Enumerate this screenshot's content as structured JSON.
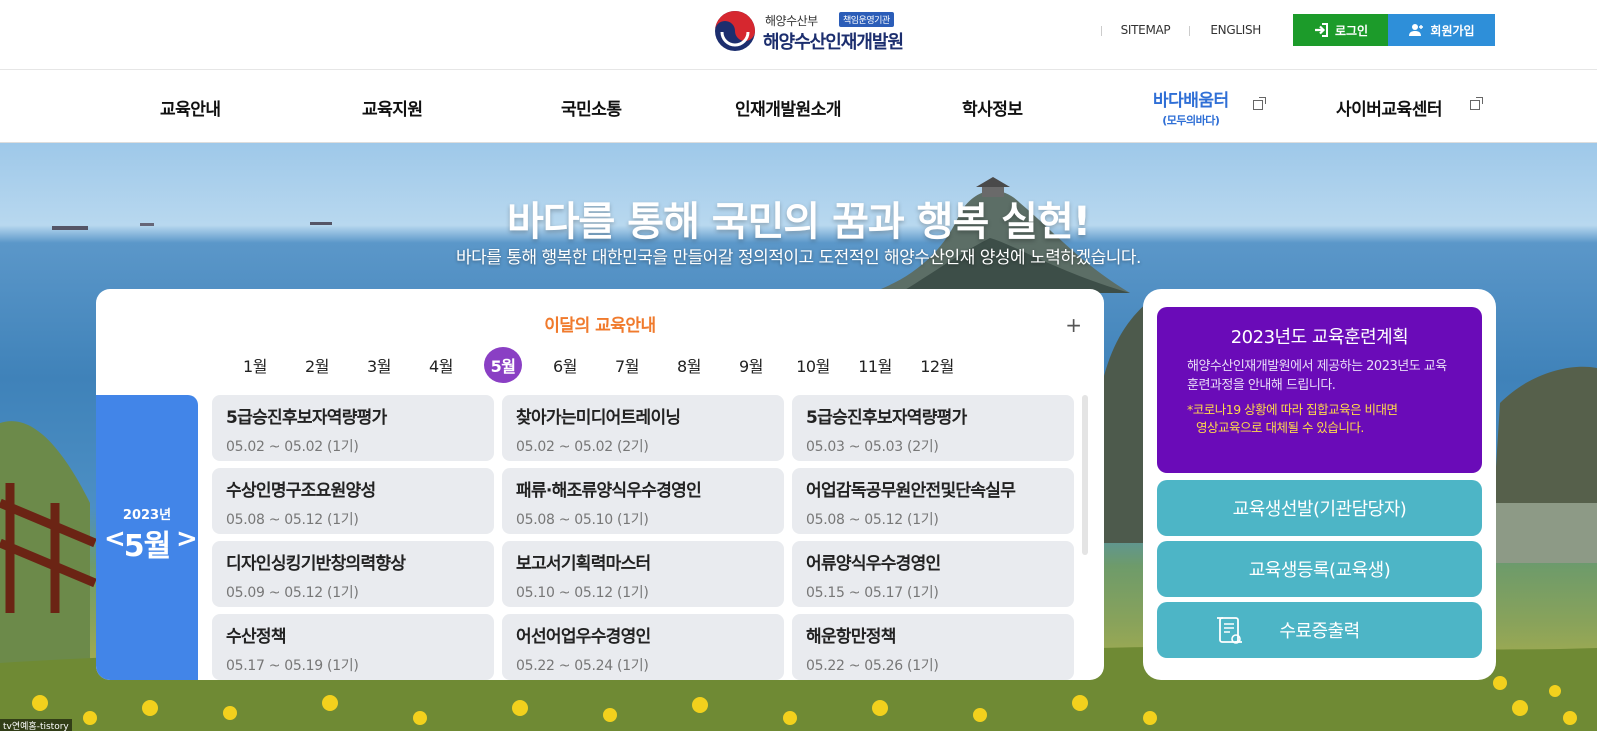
{
  "header": {
    "ministry": "해양수산부",
    "badge": "책임운영기관",
    "org_name": "해양수산인재개발원",
    "links": [
      "SITEMAP",
      "ENGLISH"
    ],
    "login_label": "로그인",
    "join_label": "회원가입"
  },
  "gnb": [
    {
      "label": "교육안내",
      "sub": ""
    },
    {
      "label": "교육지원",
      "sub": ""
    },
    {
      "label": "국민소통",
      "sub": ""
    },
    {
      "label": "인재개발원소개",
      "sub": ""
    },
    {
      "label": "학사정보",
      "sub": ""
    },
    {
      "label": "바다배움터",
      "sub": "(모두의바다)"
    },
    {
      "label": "사이버교육센터",
      "sub": ""
    }
  ],
  "hero": {
    "title": "바다를 통해 국민의 꿈과 행복 실현!",
    "subtitle": "바다를 통해 행복한 대한민국을 만들어갈 정의적이고 도전적인 해양수산인재 양성에 노력하겠습니다."
  },
  "schedule": {
    "title": "이달의 교육안내",
    "plus": "+",
    "months": [
      "1월",
      "2월",
      "3월",
      "4월",
      "5월",
      "6월",
      "7월",
      "8월",
      "9월",
      "10월",
      "11월",
      "12월"
    ],
    "active_month_index": 4,
    "year": "2023년",
    "current_month": "5월",
    "prev": "<",
    "next": ">",
    "courses": [
      {
        "title": "5급승진후보자역량평가",
        "date": "05.02 ~ 05.02 (1기)"
      },
      {
        "title": "찾아가는미디어트레이닝",
        "date": "05.02 ~ 05.02 (2기)"
      },
      {
        "title": "5급승진후보자역량평가",
        "date": "05.03 ~ 05.03 (2기)"
      },
      {
        "title": "수상인명구조요원양성",
        "date": "05.08 ~ 05.12 (1기)"
      },
      {
        "title": "패류·해조류양식우수경영인",
        "date": "05.08 ~ 05.10 (1기)"
      },
      {
        "title": "어업감독공무원안전및단속실무",
        "date": "05.08 ~ 05.12 (1기)"
      },
      {
        "title": "디자인싱킹기반창의력향상",
        "date": "05.09 ~ 05.12 (1기)"
      },
      {
        "title": "보고서기획력마스터",
        "date": "05.10 ~ 05.12 (1기)"
      },
      {
        "title": "어류양식우수경영인",
        "date": "05.15 ~ 05.17 (1기)"
      },
      {
        "title": "수산정책",
        "date": "05.17 ~ 05.19 (1기)"
      },
      {
        "title": "어선어업우수경영인",
        "date": "05.22 ~ 05.24 (1기)"
      },
      {
        "title": "해운항만정책",
        "date": "05.22 ~ 05.26 (1기)"
      }
    ]
  },
  "side_panel": {
    "plan_title": "2023년도 교육훈련계획",
    "plan_desc": "해양수산인재개발원에서 제공하는 2023년도 교육훈련과정을 안내해 드립니다.",
    "plan_note": "*코로나19 상황에 따라 집합교육은 비대면 영상교육으로 대체될 수 있습니다.",
    "buttons": [
      "교육생선발(기관담당자)",
      "교육생등록(교육생)",
      "수료증출력"
    ]
  },
  "footer_tag": "tv연예홈-tistory",
  "colors": {
    "accent_orange": "#f07a2c",
    "month_active": "#8a3fc4",
    "side_blue": "#4285e8",
    "plan_purple": "#6a0bb8",
    "teal_button": "#4db5c6",
    "login_green": "#1c9b2a",
    "join_blue": "#2e8fd9"
  }
}
